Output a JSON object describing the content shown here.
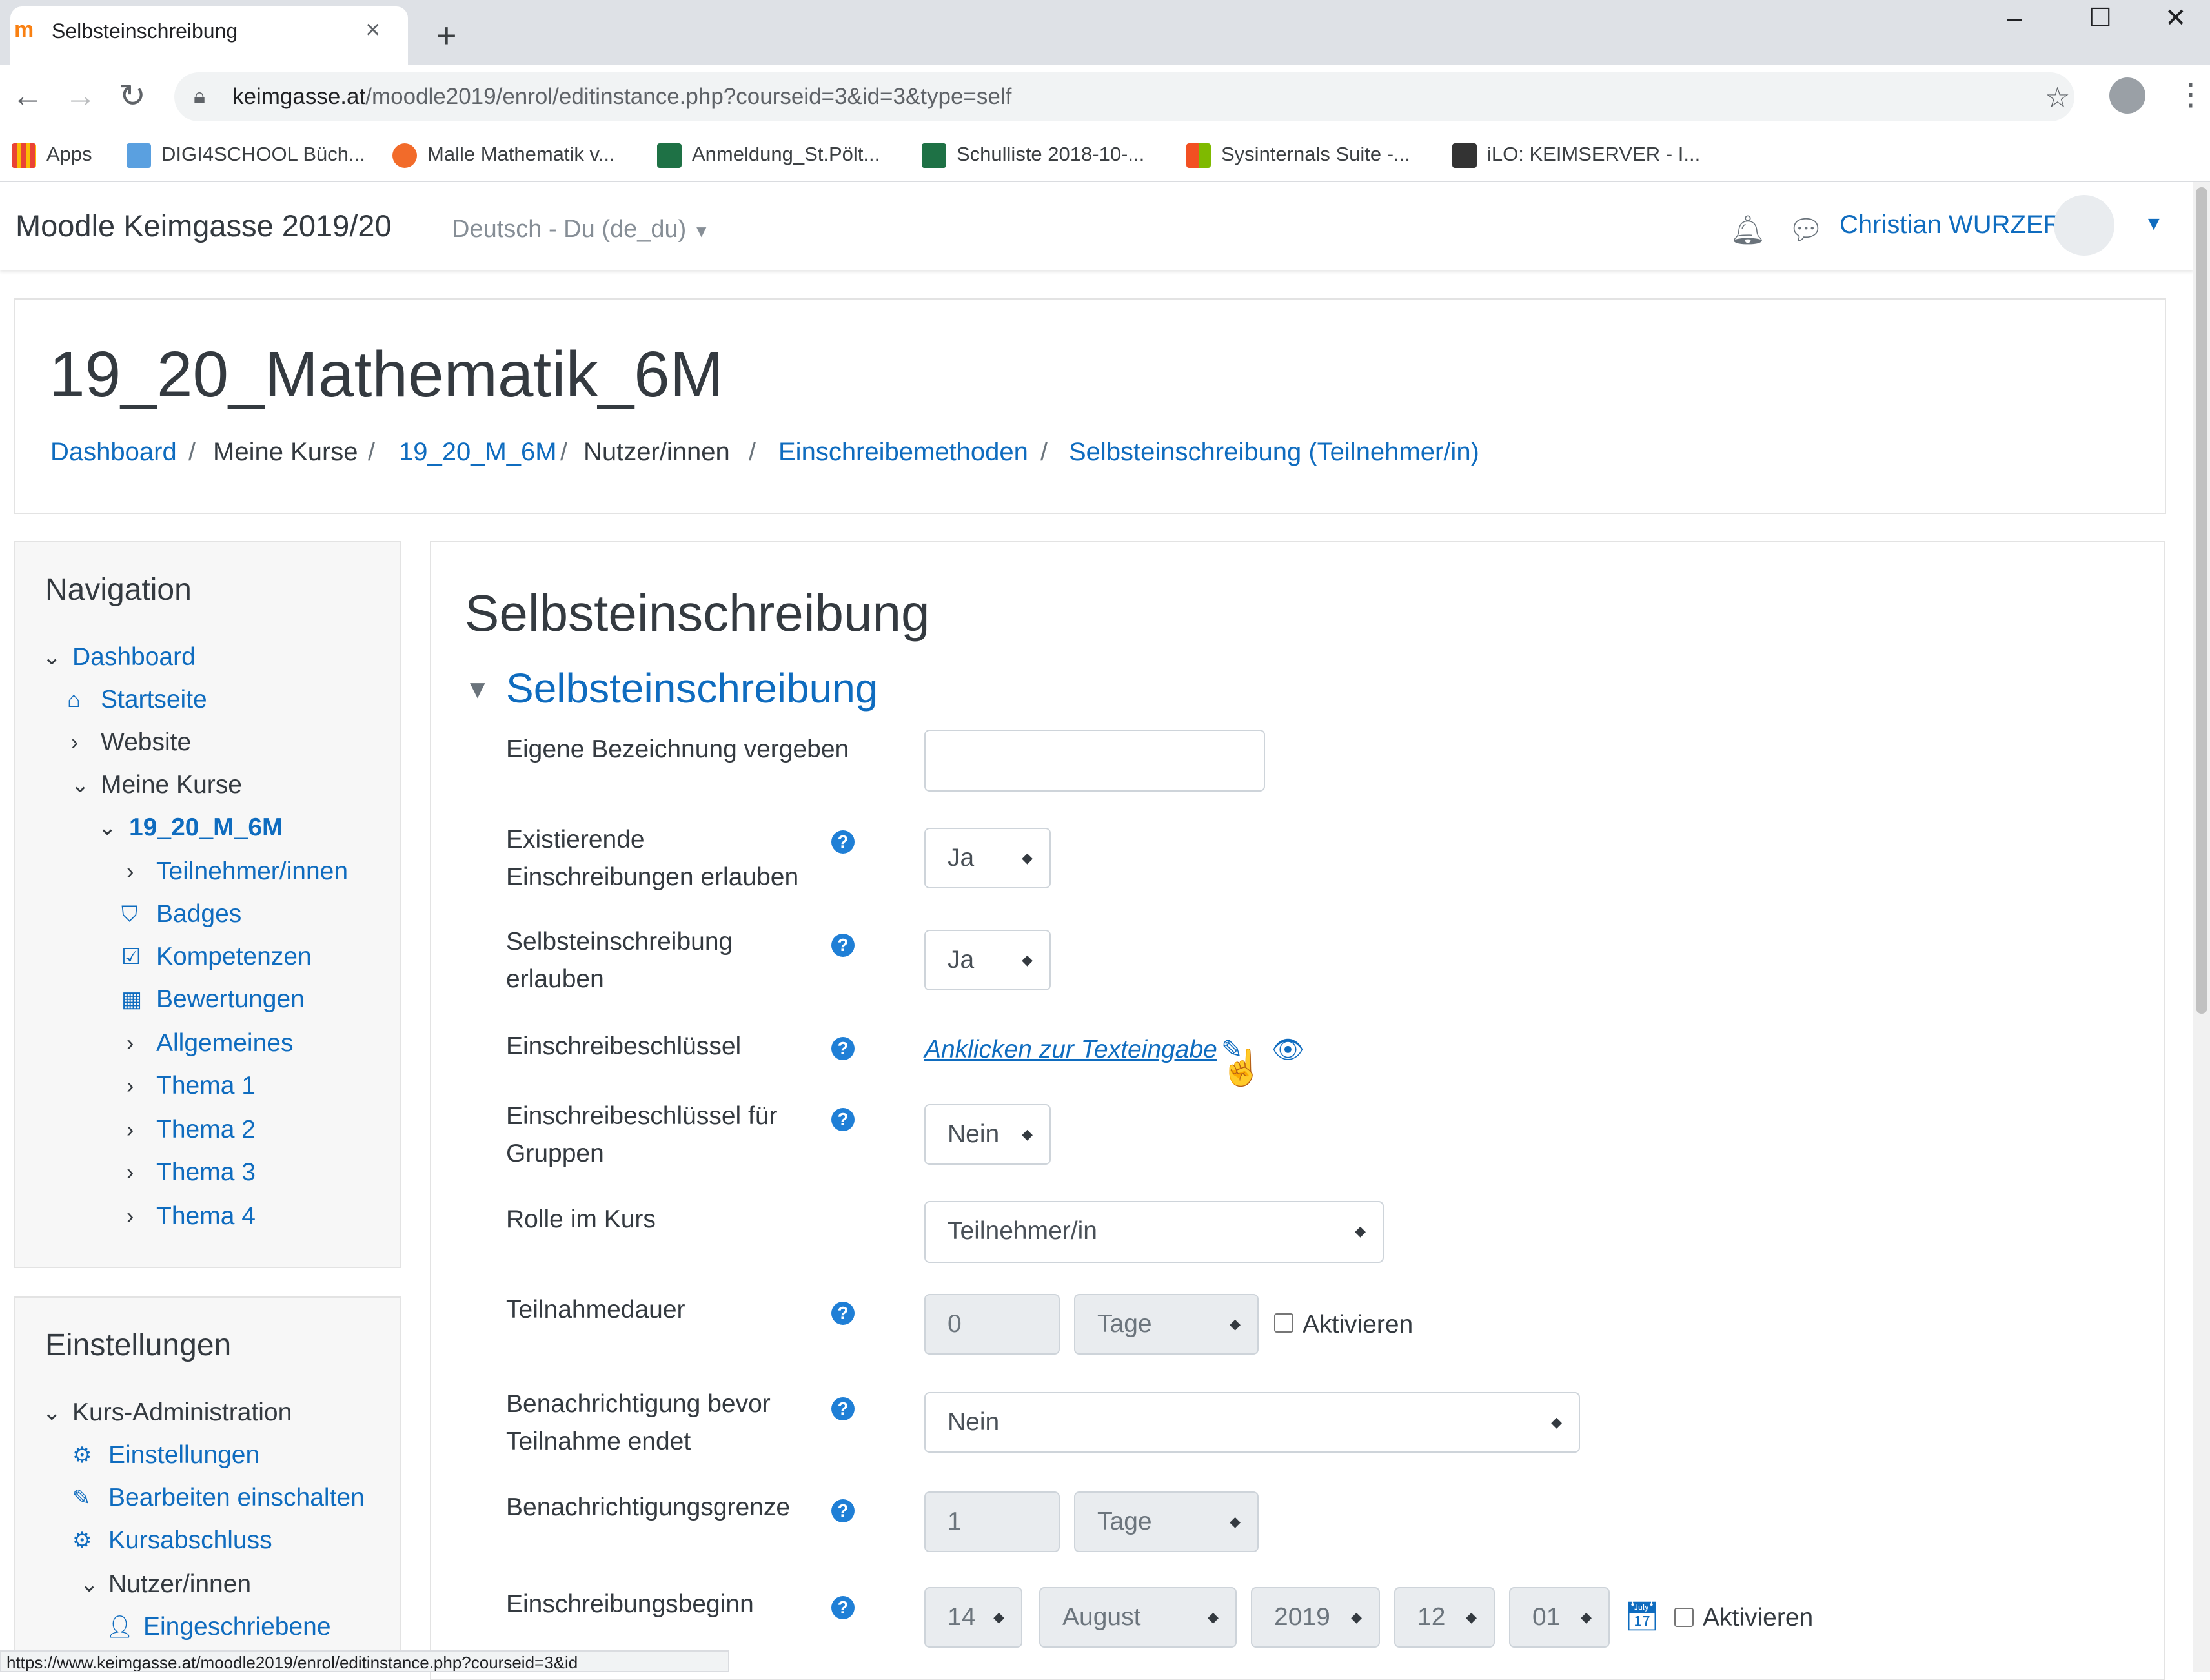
{
  "browser": {
    "tab_title": "Selbsteinschreibung",
    "tab_favicon": "moodle-icon",
    "url_domain": "keimgasse.at",
    "url_path": "/moodle2019/enrol/editinstance.php?courseid=3&id=3&type=self",
    "bookmarks": [
      {
        "label": "Apps",
        "icon": "apps-grid-icon",
        "color": "#4285f4"
      },
      {
        "label": "DIGI4SCHOOL Büch...",
        "icon": "digi4school-icon",
        "color": "#5aa0e0"
      },
      {
        "label": "Malle Mathematik v...",
        "icon": "malle-icon",
        "color": "#f26b2a"
      },
      {
        "label": "Anmeldung_St.Pölt...",
        "icon": "excel-icon",
        "color": "#1e7145"
      },
      {
        "label": "Schulliste 2018-10-...",
        "icon": "excel-icon",
        "color": "#1e7145"
      },
      {
        "label": "Sysinternals Suite -...",
        "icon": "microsoft-icon",
        "color": "#f25022"
      },
      {
        "label": "iLO: KEIMSERVER - I...",
        "icon": "ilo-icon",
        "color": "#333333"
      }
    ],
    "status_url": "https://www.keimgasse.at/moodle2019/enrol/editinstance.php?courseid=3&id"
  },
  "moodle": {
    "site_name": "Moodle Keimgasse 2019/20",
    "language": "Deutsch - Du (de_du)",
    "user_name": "Christian WURZER",
    "course_title": "19_20_Mathematik_6M",
    "breadcrumb": [
      "Dashboard",
      "Meine Kurse",
      "19_20_M_6M",
      "Nutzer/innen",
      "Einschreibemethoden",
      "Selbsteinschreibung (Teilnehmer/in)"
    ],
    "navigation": {
      "title": "Navigation",
      "items": [
        "Dashboard",
        "Startseite",
        "Website",
        "Meine Kurse",
        "19_20_M_6M",
        "Teilnehmer/innen",
        "Badges",
        "Kompetenzen",
        "Bewertungen",
        "Allgemeines",
        "Thema 1",
        "Thema 2",
        "Thema 3",
        "Thema 4"
      ]
    },
    "settings": {
      "title": "Einstellungen",
      "items": [
        "Kurs-Administration",
        "Einstellungen",
        "Bearbeiten einschalten",
        "Kursabschluss",
        "Nutzer/innen",
        "Eingeschriebene"
      ]
    },
    "page_heading": "Selbsteinschreibung",
    "section_legend": "Selbsteinschreibung",
    "form": {
      "custom_name_label": "Eigene Bezeichnung vergeben",
      "custom_name_value": "",
      "existing_label_1": "Existierende",
      "existing_label_2": "Einschreibungen erlauben",
      "existing_value": "Ja",
      "self_label_1": "Selbsteinschreibung",
      "self_label_2": "erlauben",
      "self_value": "Ja",
      "key_label": "Einschreibeschlüssel",
      "key_link": "Anklicken zur Texteingabe",
      "groupkey_label_1": "Einschreibeschlüssel für",
      "groupkey_label_2": "Gruppen",
      "groupkey_value": "Nein",
      "role_label": "Rolle im Kurs",
      "role_value": "Teilnehmer/in",
      "duration_label": "Teilnahmedauer",
      "duration_value": "0",
      "duration_unit": "Tage",
      "duration_enable": "Aktivieren",
      "notify_label_1": "Benachrichtigung bevor",
      "notify_label_2": "Teilnahme endet",
      "notify_value": "Nein",
      "threshold_label": "Benachrichtigungsgrenze",
      "threshold_value": "1",
      "threshold_unit": "Tage",
      "start_label": "Einschreibungsbeginn",
      "start_day": "14",
      "start_month": "August",
      "start_year": "2019",
      "start_hour": "12",
      "start_minute": "01",
      "start_enable": "Aktivieren"
    }
  }
}
